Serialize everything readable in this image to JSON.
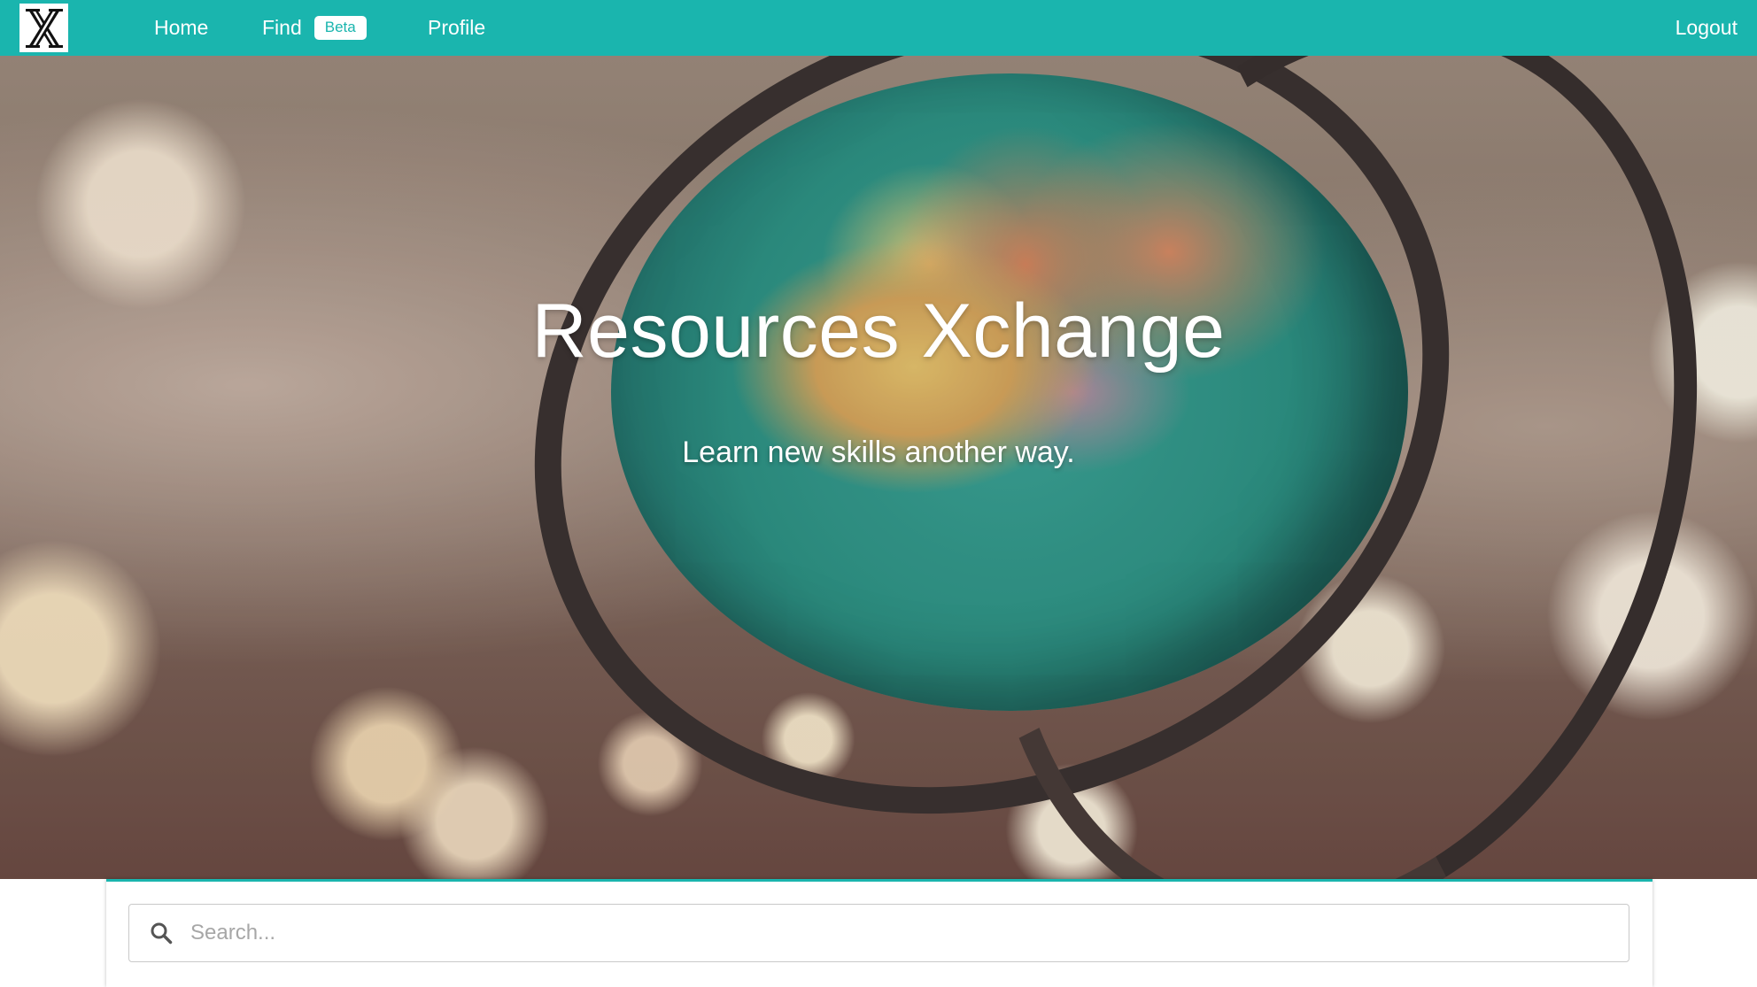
{
  "brand": {
    "logo_letter": "X",
    "logo_icon": "xchange-logo-icon"
  },
  "nav": {
    "home_label": "Home",
    "find_label": "Find",
    "find_badge": "Beta",
    "profile_label": "Profile",
    "logout_label": "Logout"
  },
  "hero": {
    "title": "Resources Xchange",
    "subtitle": "Learn new skills another way."
  },
  "search": {
    "placeholder": "Search...",
    "value": "",
    "icon": "search-icon"
  },
  "colors": {
    "accent": "#1ab5ae",
    "nav_text": "#ffffff",
    "search_border": "#c9c9c9",
    "placeholder": "#a7a7a7"
  }
}
